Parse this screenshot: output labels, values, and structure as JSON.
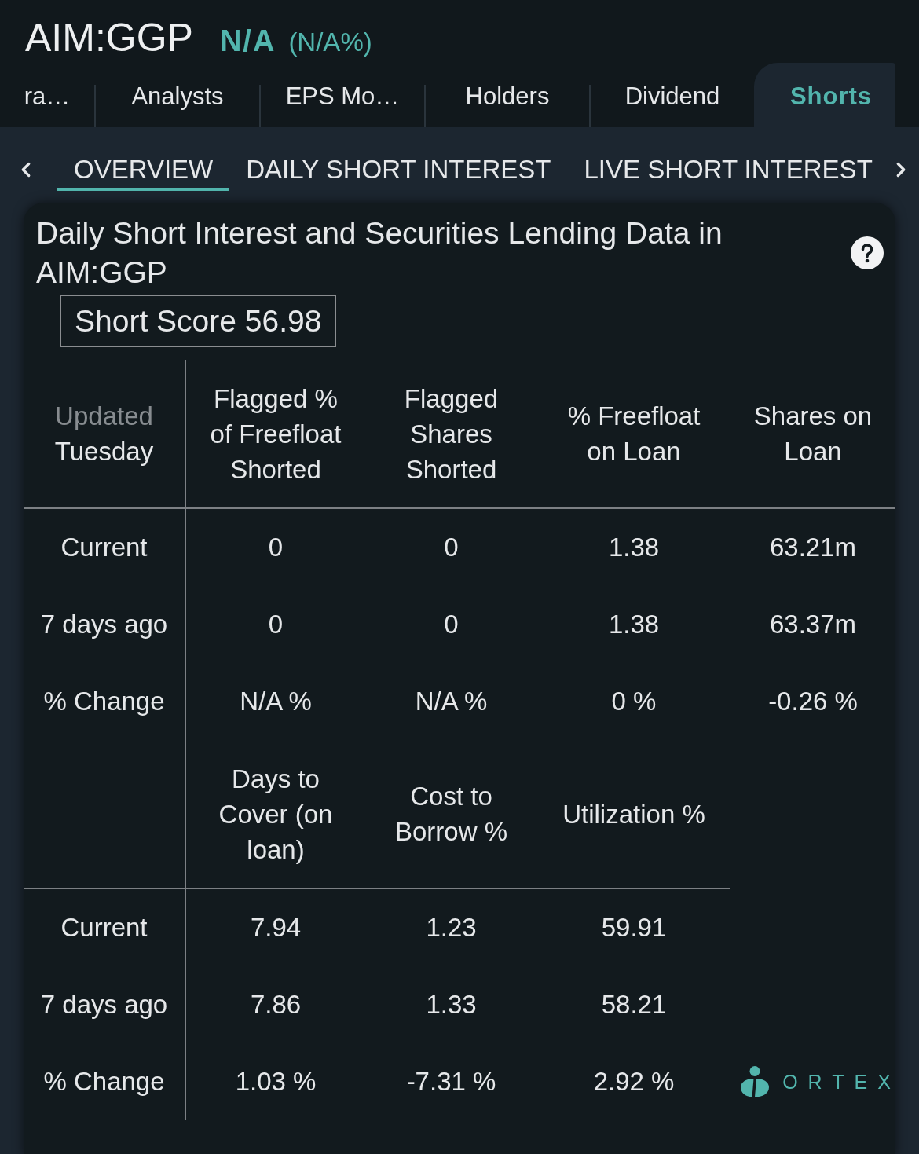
{
  "header": {
    "symbol": "AIM:GGP",
    "price": "N/A",
    "change": "(N/A%)"
  },
  "tabs": [
    {
      "label": "ra…",
      "selected": false
    },
    {
      "label": "Analysts",
      "selected": false
    },
    {
      "label": "EPS Mo…",
      "selected": false
    },
    {
      "label": "Holders",
      "selected": false
    },
    {
      "label": "Dividend",
      "selected": false
    },
    {
      "label": "Shorts",
      "selected": true
    }
  ],
  "subtabs": [
    {
      "label": "OVERVIEW",
      "selected": true
    },
    {
      "label": "DAILY SHORT INTEREST",
      "selected": false
    },
    {
      "label": "LIVE SHORT INTEREST",
      "selected": false
    }
  ],
  "card": {
    "title": "Daily Short Interest and Securities Lending Data in AIM:GGP",
    "short_score": "Short Score 56.98",
    "tables": [
      {
        "corner": {
          "caption": "Updated",
          "value": "Tuesday"
        },
        "columns": [
          "Flagged % of Freefloat Shorted",
          "Flagged Shares Shorted",
          "% Freefloat on Loan",
          "Shares on Loan"
        ],
        "rows": [
          {
            "label": "Current",
            "values": [
              "0",
              "0",
              "1.38",
              "63.21m"
            ]
          },
          {
            "label": "7 days ago",
            "values": [
              "0",
              "0",
              "1.38",
              "63.37m"
            ]
          },
          {
            "label": "% Change",
            "values": [
              "N/A %",
              "N/A %",
              "0 %",
              "-0.26 %"
            ]
          }
        ]
      },
      {
        "columns": [
          "Days to Cover (on loan)",
          "Cost to Borrow %",
          "Utilization %"
        ],
        "rows": [
          {
            "label": "Current",
            "values": [
              "7.94",
              "1.23",
              "59.91"
            ]
          },
          {
            "label": "7 days ago",
            "values": [
              "7.86",
              "1.33",
              "58.21"
            ]
          },
          {
            "label": "% Change",
            "values": [
              "1.03 %",
              "-7.31 %",
              "2.92 %"
            ]
          }
        ]
      }
    ],
    "logo": "ORTEX"
  }
}
